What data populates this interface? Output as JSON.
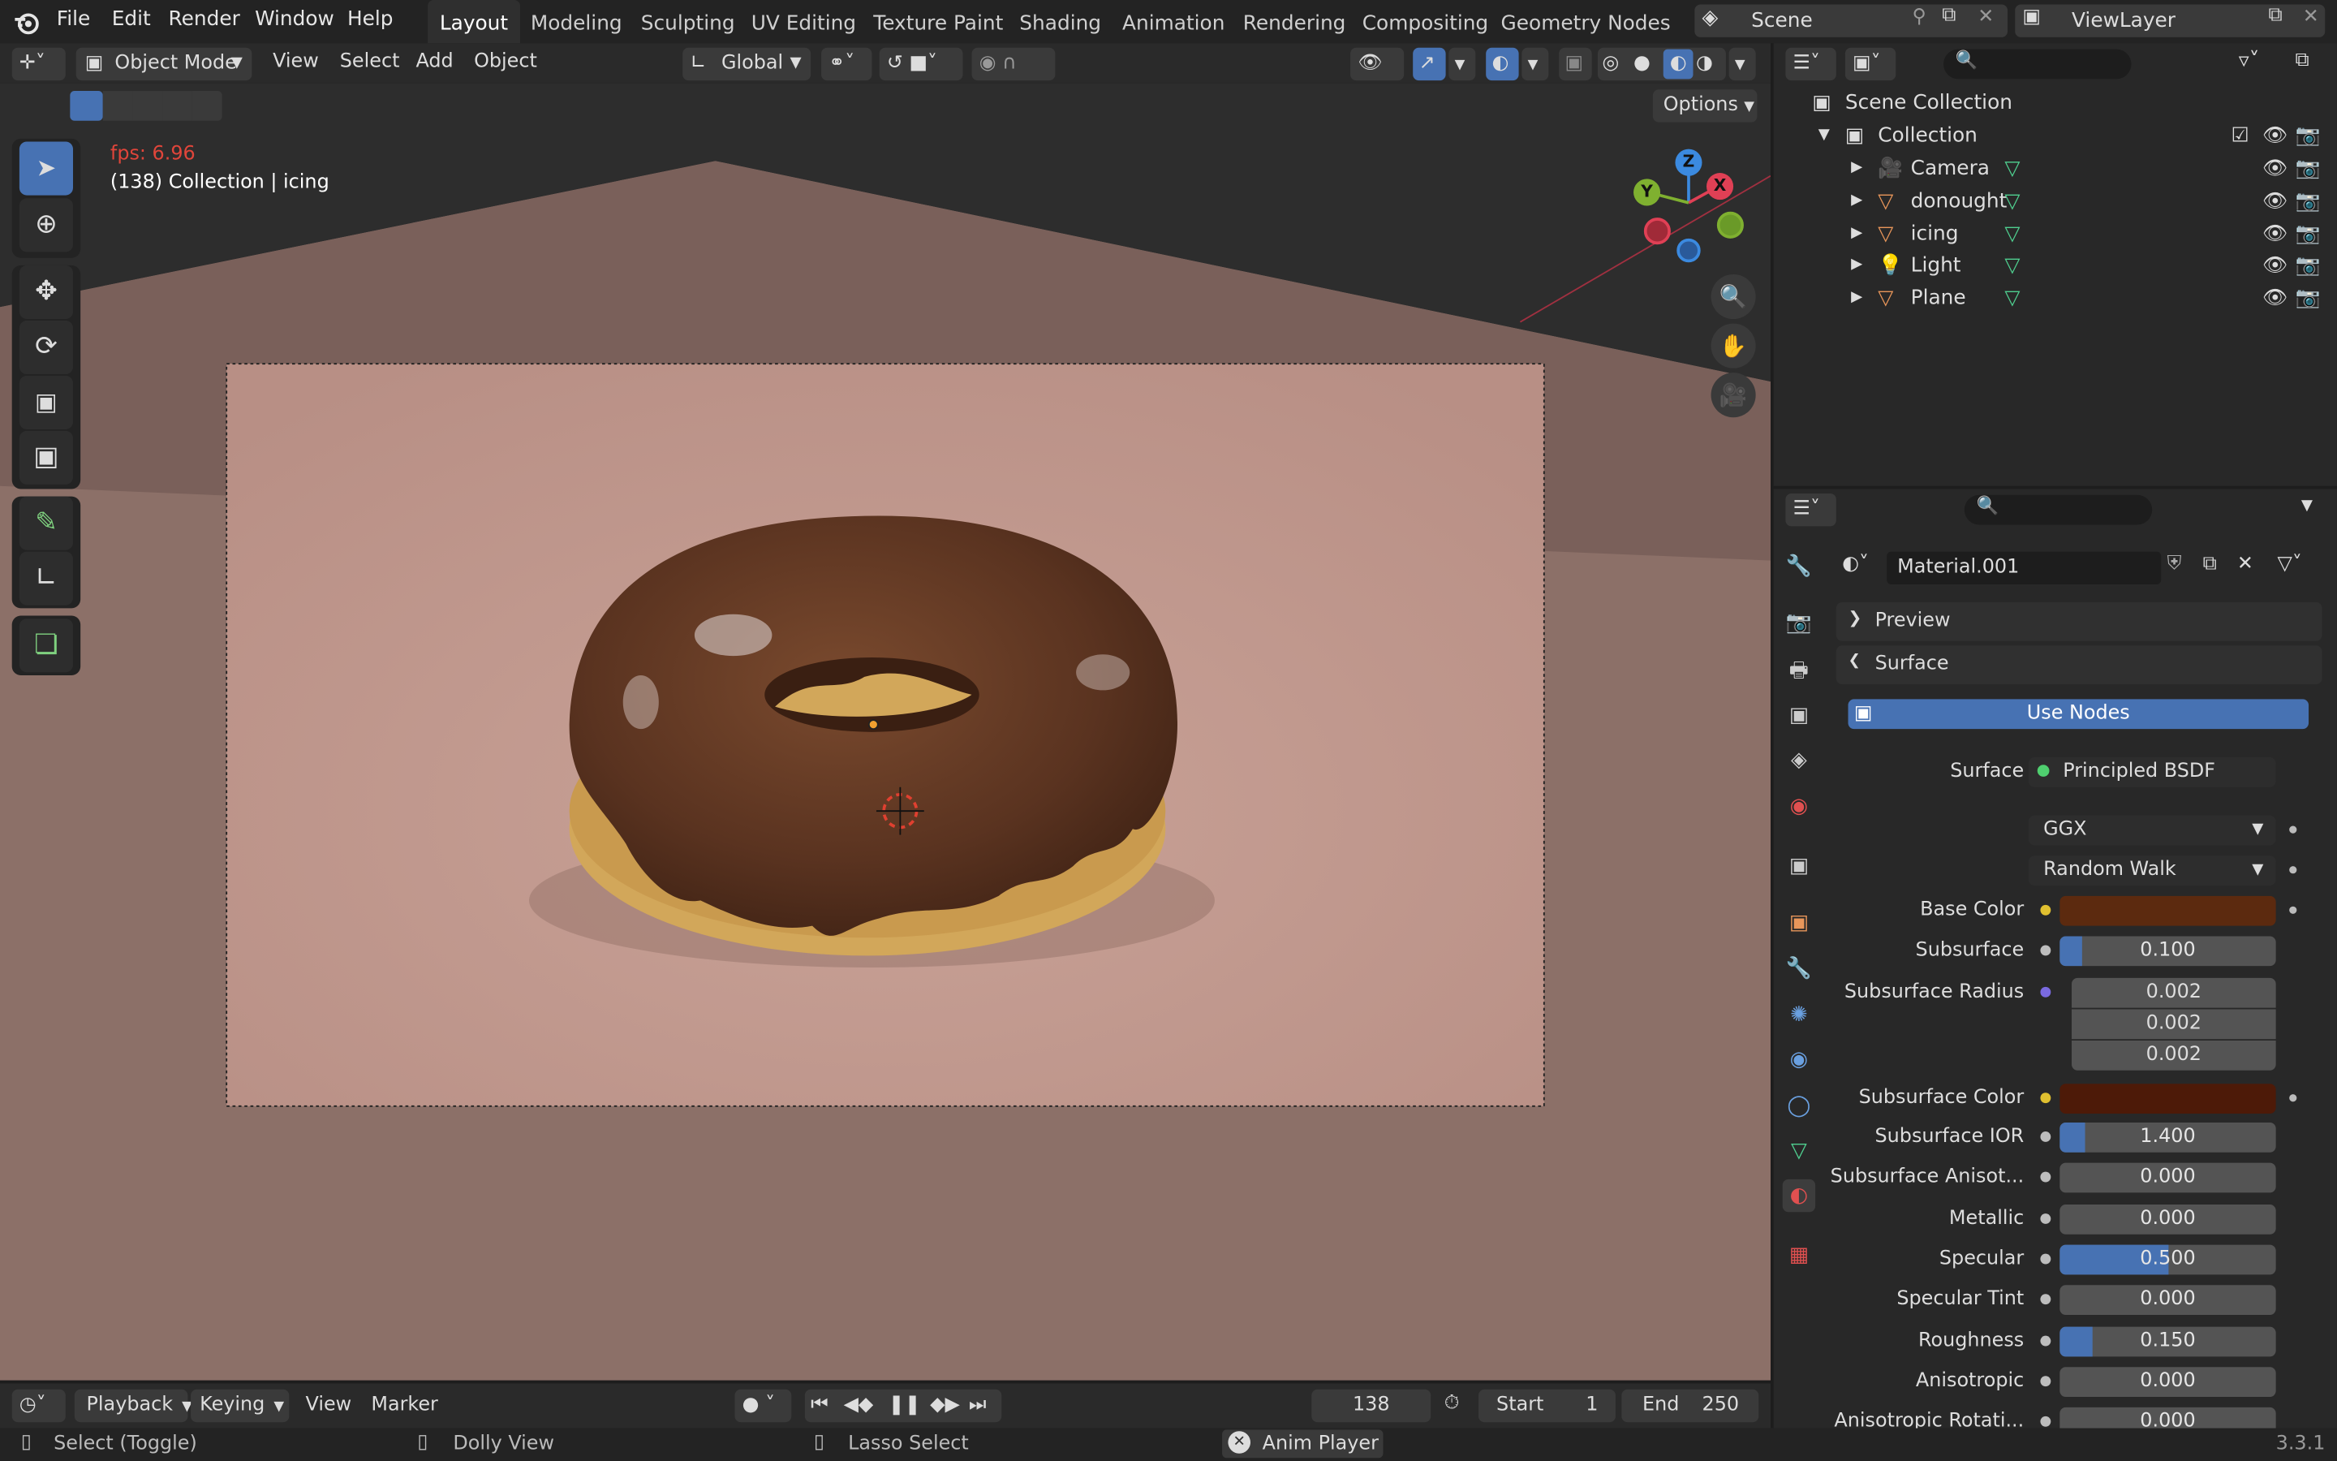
{
  "topbar": {
    "menus": [
      "File",
      "Edit",
      "Render",
      "Window",
      "Help"
    ],
    "workspaces": [
      "Layout",
      "Modeling",
      "Sculpting",
      "UV Editing",
      "Texture Paint",
      "Shading",
      "Animation",
      "Rendering",
      "Compositing",
      "Geometry Nodes"
    ],
    "active_workspace": "Layout",
    "scene_name": "Scene",
    "view_layer": "ViewLayer"
  },
  "viewport_header": {
    "mode": "Object Mode",
    "menus": [
      "View",
      "Select",
      "Add",
      "Object"
    ],
    "orientation": "Global",
    "options_label": "Options"
  },
  "viewport": {
    "fps": "fps: 6.96",
    "info": "(138) Collection | icing",
    "gizmo_axes": [
      "Z",
      "X",
      "Y"
    ]
  },
  "outliner": {
    "scene_collection": "Scene Collection",
    "collection": "Collection",
    "objects": [
      {
        "name": "Camera",
        "icon": "camera-icon",
        "color": "#e8965a"
      },
      {
        "name": "donought",
        "icon": "mesh-icon",
        "color": "#e8965a"
      },
      {
        "name": "icing",
        "icon": "mesh-icon",
        "color": "#e8965a"
      },
      {
        "name": "Light",
        "icon": "light-icon",
        "color": "#e8965a"
      },
      {
        "name": "Plane",
        "icon": "mesh-icon",
        "color": "#e8965a"
      }
    ]
  },
  "properties": {
    "material_name": "Material.001",
    "preview_label": "Preview",
    "surface_panel": "Surface",
    "use_nodes": "Use Nodes",
    "surface_label": "Surface",
    "surface_shader": "Principled BSDF",
    "distribution": "GGX",
    "subsurface_method": "Random Walk",
    "base_color_label": "Base Color",
    "base_color": "#5c2a0f",
    "subsurface_color_label": "Subsurface Color",
    "subsurface_color": "#4d1a08",
    "subsurface_radius_label": "Subsurface Radius",
    "subsurface_radius": [
      "0.002",
      "0.002",
      "0.002"
    ],
    "rows": [
      {
        "label": "Subsurface",
        "value": "0.100",
        "fill": 0.1
      },
      {
        "label": "Subsurface IOR",
        "value": "1.400",
        "fill": 0.12
      },
      {
        "label": "Subsurface Anisot...",
        "value": "0.000",
        "fill": 0
      },
      {
        "label": "Metallic",
        "value": "0.000",
        "fill": 0
      },
      {
        "label": "Specular",
        "value": "0.500",
        "fill": 0.5
      },
      {
        "label": "Specular Tint",
        "value": "0.000",
        "fill": 0
      },
      {
        "label": "Roughness",
        "value": "0.150",
        "fill": 0.15
      },
      {
        "label": "Anisotropic",
        "value": "0.000",
        "fill": 0
      },
      {
        "label": "Anisotropic Rotati...",
        "value": "0.000",
        "fill": 0
      }
    ]
  },
  "timeline": {
    "menus": [
      "Playback",
      "Keying",
      "View",
      "Marker"
    ],
    "current_frame": "138",
    "start_label": "Start",
    "start": "1",
    "end_label": "End",
    "end": "250"
  },
  "status": {
    "select": "Select (Toggle)",
    "dolly": "Dolly View",
    "lasso": "Lasso Select",
    "anim_player": "Anim Player",
    "version": "3.3.1"
  },
  "colors": {
    "accent": "#4772b3",
    "fps": "#e0453a"
  }
}
